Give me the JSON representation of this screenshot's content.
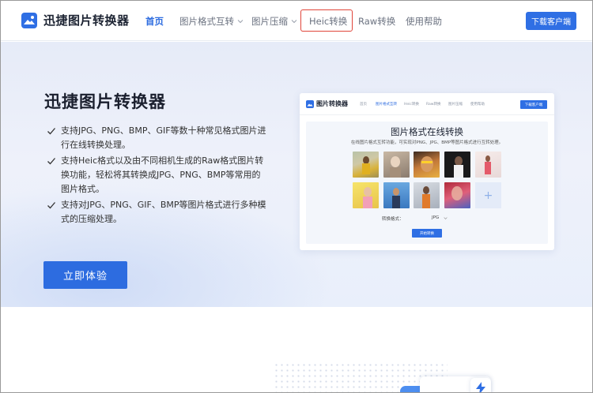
{
  "header": {
    "logo_text": "迅捷图片转换器",
    "nav": [
      {
        "label": "首页",
        "active": true
      },
      {
        "label": "图片格式互转",
        "has_dropdown": true
      },
      {
        "label": "图片压缩",
        "has_dropdown": true
      },
      {
        "label": "Heic转换",
        "highlighted": true
      },
      {
        "label": "Raw转换"
      },
      {
        "label": "使用帮助"
      }
    ],
    "download_label": "下载客户端"
  },
  "hero": {
    "title": "迅捷图片转换器",
    "features": [
      "支持JPG、PNG、BMP、GIF等数十种常见格式图片进行在线转换处理。",
      "支持Heic格式以及由不同相机生成的Raw格式图片转换功能，轻松将其转换成JPG、PNG、BMP等常用的图片格式。",
      "支持对JPG、PNG、GIF、BMP等图片格式进行多种模式的压缩处理。"
    ],
    "cta_label": "立即体验"
  },
  "preview": {
    "logo_text": "图片转换器",
    "nav": [
      "首页",
      "图片格式互转",
      "Heic转换",
      "Raw转换",
      "图片压缩",
      "使用帮助"
    ],
    "download_label": "下载客户端",
    "title": "图片格式在线转换",
    "subtitle": "在线图片格式互转功能，可实现对PNG、JPG、BMP等图片格式进行互转处理。",
    "format_label": "转换格式：",
    "format_value": "JPG",
    "start_label": "开始转换",
    "plus": "+"
  },
  "colors": {
    "accent": "#2d6ce0",
    "highlight_box": "#e0453a",
    "hero_bg": "#e9eef9"
  }
}
